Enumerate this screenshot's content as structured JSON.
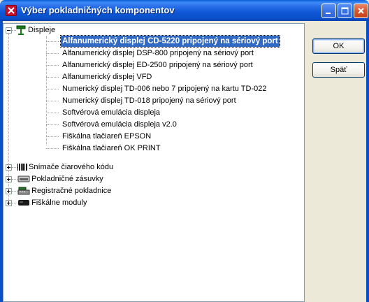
{
  "window": {
    "title": "Výber pokladničných komponentov"
  },
  "tree": {
    "root": {
      "label": "Displeje",
      "icon": "display-pole-icon",
      "expanded": true,
      "children": [
        "Alfanumerický displej CD-5220 pripojený na sériový port",
        "Alfanumerický displej DSP-800 pripojený na sériový port",
        "Alfanumerický displej ED-2500 pripojený na sériový port",
        "Alfanumerický displej VFD",
        "Numerický displej TD-006 nebo 7 pripojený na kartu TD-022",
        "Numerický displej TD-018 pripojený na sériový port",
        "Softvérová emulácia displeja",
        "Softvérová emulácia displeja v2.0",
        "Fiškálna tlačiareň EPSON",
        "Fiškálna tlačiareň OK PRINT"
      ],
      "selected_index": 0
    },
    "categories": [
      {
        "label": "Snímače čiarového kódu",
        "icon": "barcode-icon"
      },
      {
        "label": "Pokladničné zásuvky",
        "icon": "cash-drawer-icon"
      },
      {
        "label": "Registračné pokladnice",
        "icon": "cash-register-icon"
      },
      {
        "label": "Fiškálne moduly",
        "icon": "fiscal-module-icon"
      }
    ]
  },
  "buttons": {
    "ok_label": "OK",
    "back_label": "Späť"
  }
}
